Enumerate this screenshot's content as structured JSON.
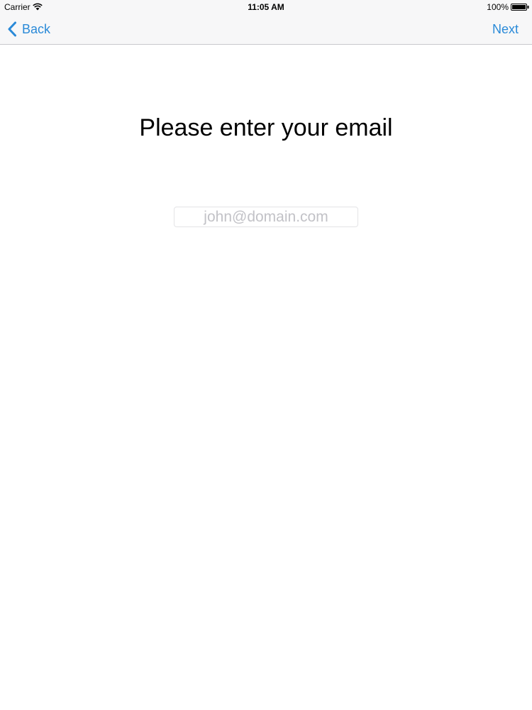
{
  "status_bar": {
    "carrier": "Carrier",
    "time": "11:05 AM",
    "battery": "100%"
  },
  "nav": {
    "back_label": "Back",
    "next_label": "Next",
    "accent_color": "#2a8ad8"
  },
  "main": {
    "title": "Please enter your email",
    "email_input": {
      "value": "",
      "placeholder": "john@domain.com"
    }
  }
}
